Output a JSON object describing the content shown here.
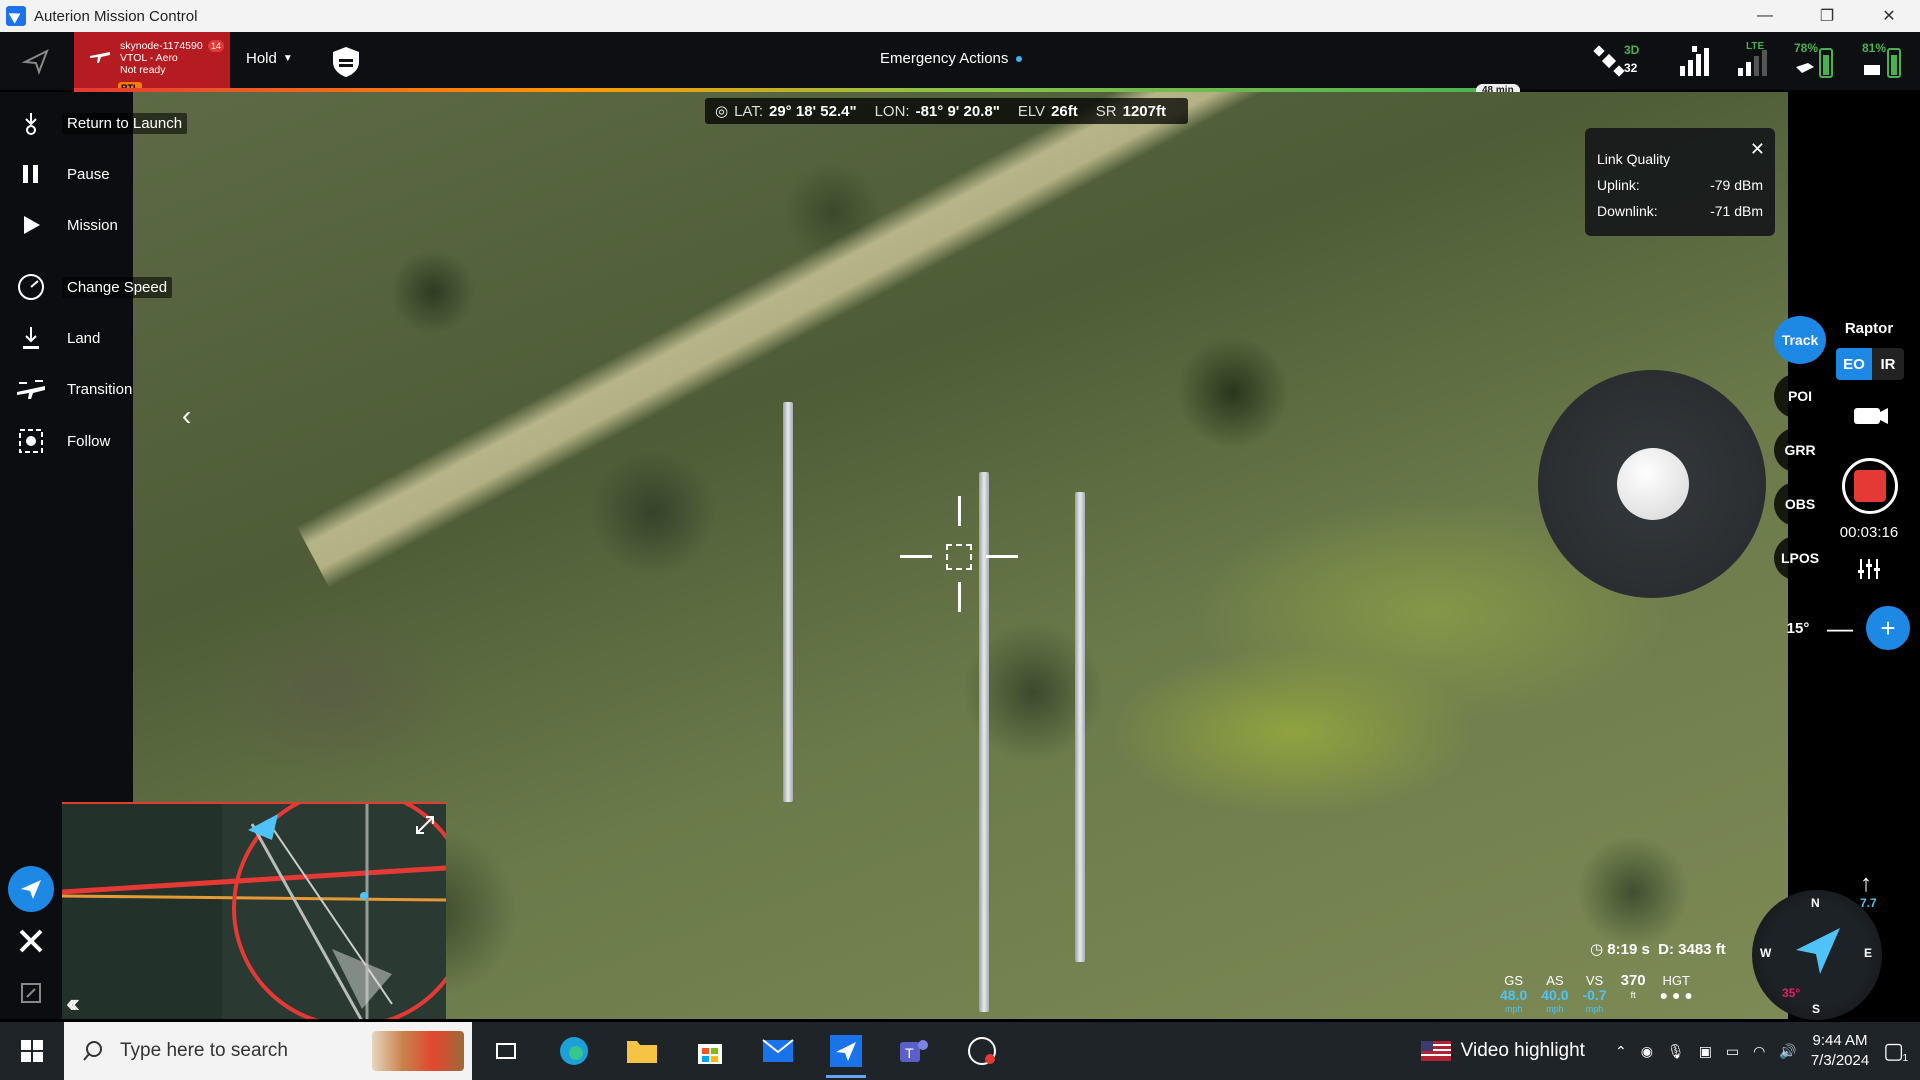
{
  "window": {
    "title": "Auterion Mission Control",
    "controls": [
      "—",
      "❐",
      "✕"
    ]
  },
  "toolbar": {
    "vehicle": {
      "line1": "skynode-1174590",
      "line2": "VTOL - Aero",
      "line3": "Not ready",
      "badge_count": "14",
      "rtl_tag": "RTL"
    },
    "mode": "Hold",
    "emergency_label": "Emergency Actions",
    "status": {
      "gps_fix": "3D",
      "gps_sats": "32",
      "lte_label": "LTE",
      "battery1": "78%",
      "battery2": "81%"
    },
    "time_left": "48 min",
    "colors": {
      "vehicle_badge": "#b41c22",
      "accent": "#1e88e5",
      "ok": "#4caf50"
    }
  },
  "telemetry": {
    "lat_label": "LAT:",
    "lat": "29° 18' 52.4\"",
    "lon_label": "LON:",
    "lon": "-81° 9' 20.8\"",
    "elv_label": "ELV",
    "elv": "26ft",
    "sr_label": "SR",
    "sr": "1207ft"
  },
  "link_quality": {
    "title": "Link Quality",
    "uplink_label": "Uplink:",
    "uplink": "-79 dBm",
    "downlink_label": "Downlink:",
    "downlink": "-71 dBm"
  },
  "sidebar": {
    "actions": [
      {
        "label": "Return to Launch",
        "icon": "return-to-launch-icon"
      },
      {
        "label": "Pause",
        "icon": "pause-icon"
      },
      {
        "label": "Mission",
        "icon": "play-icon"
      },
      {
        "label": "Change Speed",
        "icon": "speedometer-icon"
      },
      {
        "label": "Land",
        "icon": "land-icon"
      },
      {
        "label": "Transition",
        "icon": "vtol-transition-icon"
      },
      {
        "label": "Follow",
        "icon": "follow-icon"
      }
    ]
  },
  "gimbal": {
    "modes": [
      "Track",
      "POI",
      "GRR",
      "OBS",
      "LPOS"
    ],
    "active_mode": "Track",
    "payload": "Raptor",
    "eo": "EO",
    "ir": "IR",
    "record_time": "00:03:16",
    "tilt": "15°",
    "minus": "—",
    "plus": "+"
  },
  "hud": {
    "flight_time": "8:19 s",
    "distance": "D: 3483 ft",
    "gauges": [
      {
        "label": "GS",
        "value": "48.0",
        "unit": "mph"
      },
      {
        "label": "AS",
        "value": "40.0",
        "unit": "mph"
      },
      {
        "label": "VS",
        "value": "-0.7",
        "unit": "mph"
      }
    ],
    "alt": "370",
    "alt_unit": "ft",
    "hgt_label": "HGT",
    "compass": {
      "n": "N",
      "s": "S",
      "w": "W",
      "e": "E",
      "heading": "35°"
    },
    "wind": "7.7"
  },
  "taskbar": {
    "search_placeholder": "Type here to search",
    "video_highlight": "Video highlight",
    "time": "9:44 AM",
    "date": "7/3/2024",
    "notif_count": "1"
  }
}
